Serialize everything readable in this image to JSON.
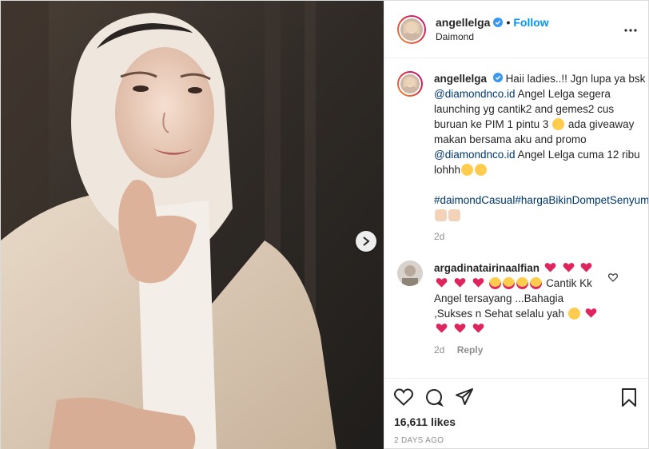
{
  "post": {
    "username": "angellelga",
    "separator": "•",
    "follow_label": "Follow",
    "location": "Daimond"
  },
  "caption": {
    "username": "angellelga",
    "text_1": "Haii ladies..!! Jgn lupa ya bsk",
    "mention_1": "@diamondnco.id",
    "text_2": "Angel Lelga segera launching yg cantik2 and gemes2 cus buruan ke PIM 1 pintu 3",
    "text_3": "ada giveaway makan bersama aku and promo",
    "mention_2": "@diamondnco.id",
    "text_4": "Angel Lelga cuma 12 ribu lohhh",
    "hashtags": "#daimondCasual#hargaBikinDompetSenyum",
    "time": "2d"
  },
  "comment": {
    "username": "argadinatairinaalfian",
    "text_1": "Cantik Kk Angel tersayang ...Bahagia ,Sukses n Sehat selalu yah",
    "time": "2d",
    "reply_label": "Reply"
  },
  "footer": {
    "likes": "16,611 likes",
    "date": "2 DAYS AGO"
  },
  "colors": {
    "link": "#0095f6",
    "mention": "#00376b",
    "heart_red": "#e0245e",
    "emoji_yellow": "#ffcc4d"
  }
}
